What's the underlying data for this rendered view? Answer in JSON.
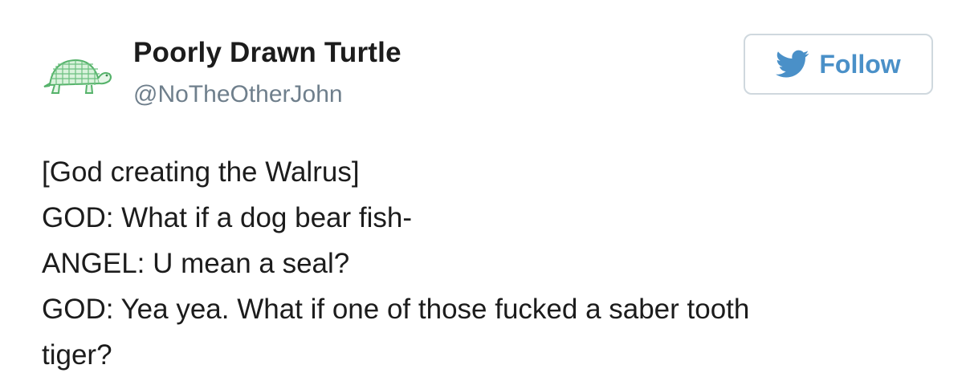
{
  "profile": {
    "display_name": "Poorly Drawn Turtle",
    "handle": "@NoTheOtherJohn",
    "avatar_icon": "turtle-avatar-icon"
  },
  "follow_button": {
    "label": "Follow",
    "icon": "twitter-bird-icon",
    "accent_color": "#4a90c8"
  },
  "tweet": {
    "lines": [
      "[God creating the Walrus]",
      "GOD: What if a dog bear fish-",
      "ANGEL: U mean a seal?",
      "GOD: Yea yea. What if one of those fucked a saber tooth",
      "tiger?"
    ]
  }
}
